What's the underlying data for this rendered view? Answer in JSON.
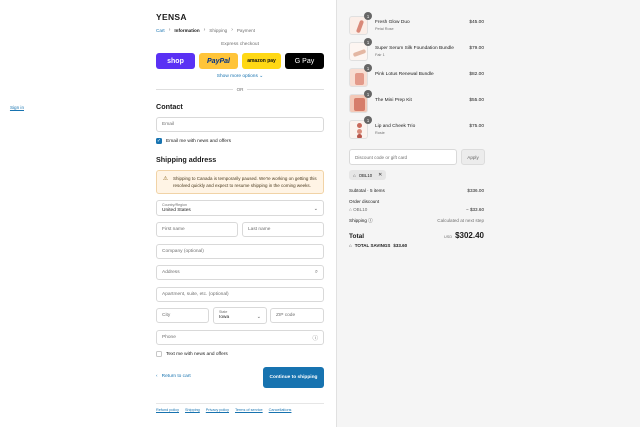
{
  "brand": "YENSA",
  "breadcrumbs": [
    "Cart",
    "Information",
    "Shipping",
    "Payment"
  ],
  "express": {
    "title": "Express checkout",
    "buttons": [
      "shop",
      "PayPal",
      "amazon pay",
      "G Pay"
    ],
    "more_options": "Show more options ⌄",
    "or": "OR"
  },
  "contact": {
    "title": "Contact",
    "sign_in": "Sign in",
    "email_placeholder": "Email",
    "news_checkbox": {
      "label": "Email me with news and offers",
      "checked": true
    }
  },
  "shipping": {
    "title": "Shipping address",
    "notice": "Shipping to Canada is temporarily paused. We're working on getting this resolved quickly and expect to resume shipping in the coming weeks.",
    "country": {
      "label": "Country/Region",
      "value": "United States"
    },
    "first_name": "First name",
    "last_name": "Last name",
    "company": "Company (optional)",
    "address": "Address",
    "apartment": "Apartment, suite, etc. (optional)",
    "city": "City",
    "state": {
      "label": "State",
      "value": "Iowa"
    },
    "zip": "ZIP code",
    "phone": "Phone",
    "text_checkbox": {
      "label": "Text me with news and offers",
      "checked": false
    }
  },
  "actions": {
    "return": "Return to cart",
    "continue": "Continue to shipping"
  },
  "footer_links": [
    "Refund policy",
    "Shipping",
    "Privacy policy",
    "Terms of service",
    "Cancellations"
  ],
  "cart": {
    "items": [
      {
        "name": "Fresh Glow Duo",
        "variant": "Petal Rose",
        "qty": "1",
        "price": "$45.00"
      },
      {
        "name": "Super Serum Silk Foundation Bundle",
        "variant": "Fair 1",
        "qty": "1",
        "price": "$79.00"
      },
      {
        "name": "Pink Lotus Renewal Bundle",
        "variant": "",
        "qty": "1",
        "price": "$82.00"
      },
      {
        "name": "The Mini Prep Kit",
        "variant": "",
        "qty": "1",
        "price": "$55.00"
      },
      {
        "name": "Lip and Cheek Trio",
        "variant": "Rosie",
        "qty": "1",
        "price": "$75.00"
      }
    ],
    "discount_placeholder": "Discount code or gift card",
    "apply": "Apply",
    "applied_code": "OBL10",
    "subtotal_label": "Subtotal · 5 items",
    "subtotal": "$336.00",
    "order_discount_label": "Order discount",
    "discount_code": "OBL10",
    "discount_amount": "− $33.60",
    "shipping_label": "Shipping",
    "shipping_value": "Calculated at next step",
    "total_label": "Total",
    "currency": "USD",
    "total": "$302.40",
    "savings_label": "TOTAL SAVINGS",
    "savings": "$33.60"
  }
}
